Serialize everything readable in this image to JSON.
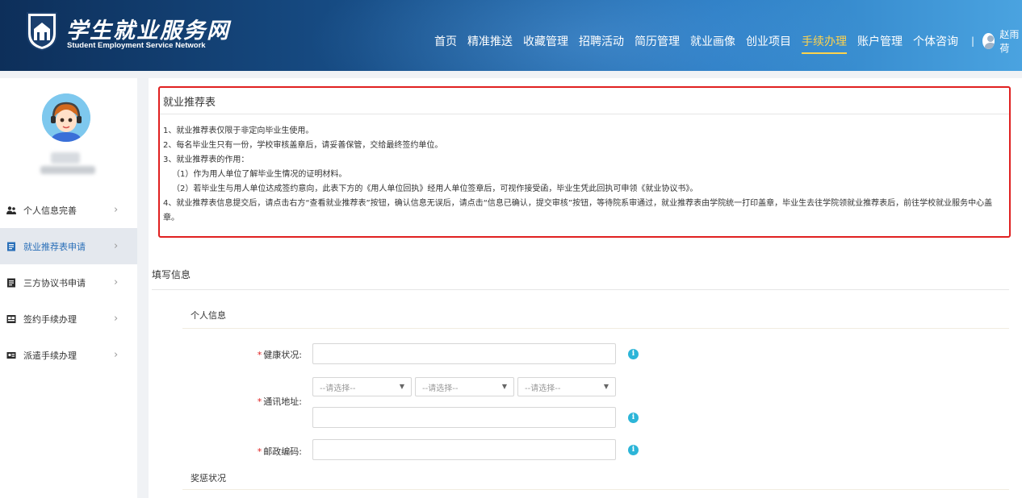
{
  "header": {
    "logo_title": "学生就业服务网",
    "logo_subtitle": "Student Employment Service Network",
    "nav": [
      {
        "label": "首页"
      },
      {
        "label": "精准推送"
      },
      {
        "label": "收藏管理"
      },
      {
        "label": "招聘活动"
      },
      {
        "label": "简历管理"
      },
      {
        "label": "就业画像"
      },
      {
        "label": "创业项目"
      },
      {
        "label": "手续办理",
        "active": true
      },
      {
        "label": "账户管理"
      },
      {
        "label": "个体咨询"
      }
    ],
    "separator": "|",
    "user_name": "赵雨荷"
  },
  "sidebar": {
    "items": [
      {
        "label": "个人信息完善",
        "icon": "user-icon"
      },
      {
        "label": "就业推荐表申请",
        "icon": "form-icon",
        "active": true
      },
      {
        "label": "三方协议书申请",
        "icon": "document-icon"
      },
      {
        "label": "签约手续办理",
        "icon": "contract-icon"
      },
      {
        "label": "派遣手续办理",
        "icon": "dispatch-icon"
      }
    ],
    "chevron": "›"
  },
  "notice": {
    "title": "就业推荐表",
    "lines": [
      "1、就业推荐表仅限于非定向毕业生使用。",
      "2、每名毕业生只有一份，学校审核盖章后，请妥善保管，交给最终签约单位。",
      "3、就业推荐表的作用：",
      "（1）作为用人单位了解毕业生情况的证明材料。",
      "（2）若毕业生与用人单位达成签约意向，此表下方的《用人单位回执》经用人单位签章后，可视作接受函，毕业生凭此回执可申领《就业协议书》。",
      "4、就业推荐表信息提交后，请点击右方“查看就业推荐表”按钮，确认信息无误后，请点击“信息已确认，提交审核”按钮，等待院系审通过，就业推荐表由学院统一打印盖章，毕业生去往学院领就业推荐表后，前往学校就业服务中心盖章。"
    ]
  },
  "form": {
    "section_title": "填写信息",
    "personal_title": "个人信息",
    "required_mark": "*",
    "health_label": "健康状况:",
    "health_value": "",
    "address_label": "通讯地址:",
    "province_placeholder": "--请选择--",
    "city_placeholder": "--请选择--",
    "district_placeholder": "--请选择--",
    "address_detail_value": "",
    "postcode_label": "邮政编码:",
    "postcode_value": "",
    "info_glyph": "i",
    "awards_title": "奖惩状况"
  },
  "colors": {
    "header_dark": "#0d2f5a",
    "header_light": "#4aa3e0",
    "active_nav": "#ffd34d",
    "notice_border": "#e02020",
    "sidebar_active_bg": "#e4e8ee",
    "sidebar_active_text": "#2a6fb8",
    "info_icon": "#2cb5d8",
    "required": "#e02020"
  }
}
